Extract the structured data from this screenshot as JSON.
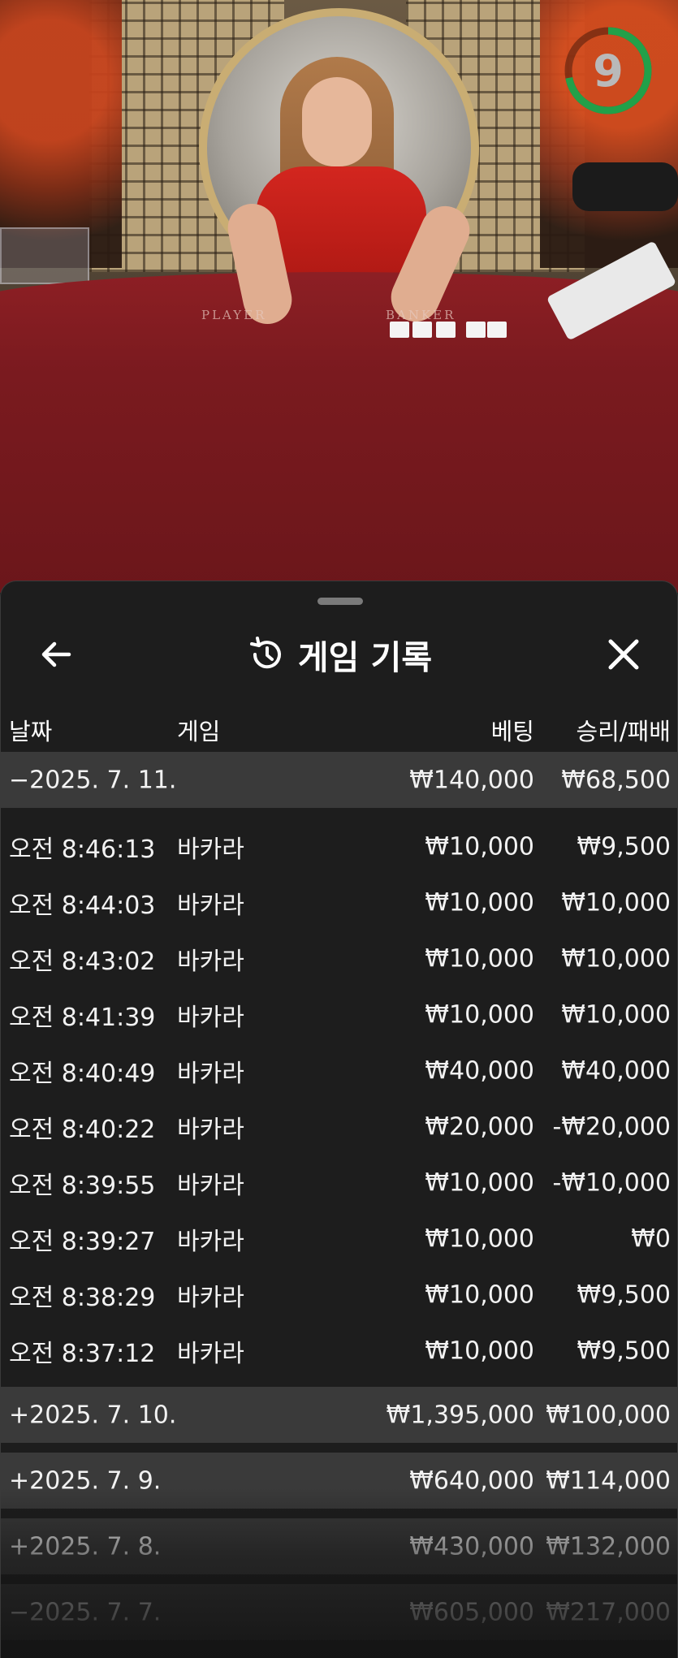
{
  "timer": {
    "value": "9",
    "progress": 0.72,
    "color": "#22a049"
  },
  "sheet": {
    "title": "게임 기록",
    "title_icon": "history-icon",
    "back_icon": "arrow-left-icon",
    "close_icon": "close-icon"
  },
  "columns": {
    "date": "날짜",
    "game": "게임",
    "bet": "베팅",
    "win_loss": "승리/패배"
  },
  "groups": [
    {
      "date": "−2025. 7. 11.",
      "bet": "₩140,000",
      "win_loss": "₩68,500",
      "expanded": true,
      "rows": [
        {
          "time": "오전 8:46:13",
          "game": "바카라",
          "bet": "₩10,000",
          "win_loss": "₩9,500"
        },
        {
          "time": "오전 8:44:03",
          "game": "바카라",
          "bet": "₩10,000",
          "win_loss": "₩10,000"
        },
        {
          "time": "오전 8:43:02",
          "game": "바카라",
          "bet": "₩10,000",
          "win_loss": "₩10,000"
        },
        {
          "time": "오전 8:41:39",
          "game": "바카라",
          "bet": "₩10,000",
          "win_loss": "₩10,000"
        },
        {
          "time": "오전 8:40:49",
          "game": "바카라",
          "bet": "₩40,000",
          "win_loss": "₩40,000"
        },
        {
          "time": "오전 8:40:22",
          "game": "바카라",
          "bet": "₩20,000",
          "win_loss": "-₩20,000"
        },
        {
          "time": "오전 8:39:55",
          "game": "바카라",
          "bet": "₩10,000",
          "win_loss": "-₩10,000"
        },
        {
          "time": "오전 8:39:27",
          "game": "바카라",
          "bet": "₩10,000",
          "win_loss": "₩0"
        },
        {
          "time": "오전 8:38:29",
          "game": "바카라",
          "bet": "₩10,000",
          "win_loss": "₩9,500"
        },
        {
          "time": "오전 8:37:12",
          "game": "바카라",
          "bet": "₩10,000",
          "win_loss": "₩9,500"
        }
      ]
    },
    {
      "date": "+2025. 7. 10.",
      "bet": "₩1,395,000",
      "win_loss": "₩100,000",
      "expanded": false
    },
    {
      "date": "+2025. 7. 9.",
      "bet": "₩640,000",
      "win_loss": "₩114,000",
      "expanded": false
    },
    {
      "date": "+2025. 7. 8.",
      "bet": "₩430,000",
      "win_loss": "₩132,000",
      "expanded": false
    },
    {
      "date": "−2025. 7. 7.",
      "bet": "₩605,000",
      "win_loss": "₩217,000",
      "expanded": true
    }
  ],
  "table_labels": {
    "player": "PLAYER",
    "banker": "BANKER"
  }
}
